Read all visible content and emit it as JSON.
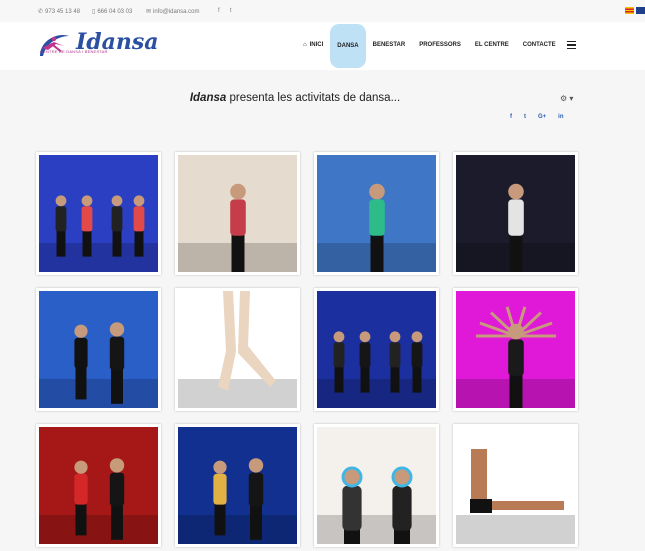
{
  "topbar": {
    "phone1": "973 45 13 48",
    "phone2": "666 04 03 03",
    "email": "info@idansa.com",
    "social": [
      "f",
      "t"
    ]
  },
  "logo": {
    "name": "Idansa",
    "tagline": "CENTRE DE DANSA I BENESTAR"
  },
  "nav": {
    "items": [
      "INICI",
      "DANSA",
      "BENESTAR",
      "PROFESSORS",
      "EL CENTRE",
      "CONTACTE"
    ],
    "active": "DANSA"
  },
  "page": {
    "brand": "Idansa",
    "headline_rest": "presenta les activitats de dansa...",
    "share": [
      "f",
      "t",
      "G+",
      "in"
    ]
  },
  "gallery": [
    {
      "bg": "#2a3fc2",
      "accent": "#e24a4a",
      "subject": "kids-dancers"
    },
    {
      "bg": "#e6dbcf",
      "accent": "#c53d4a",
      "subject": "girl-stretching-mat"
    },
    {
      "bg": "#3f77c6",
      "accent": "#2dbb8a",
      "subject": "girl-arms-up"
    },
    {
      "bg": "#1b1b2b",
      "accent": "#e4e4e4",
      "subject": "girl-sitting-stage"
    },
    {
      "bg": "#2b5fc8",
      "accent": "#111111",
      "subject": "two-dancers-floor"
    },
    {
      "bg": "#ffffff",
      "accent": "#e9d5c0",
      "subject": "pointe-shoes"
    },
    {
      "bg": "#1c2f9e",
      "accent": "#161616",
      "subject": "group-on-stage"
    },
    {
      "bg": "#e018d8",
      "accent": "#1a1a1a",
      "subject": "many-arms-dancer"
    },
    {
      "bg": "#a61818",
      "accent": "#d42828",
      "subject": "salsa-couple"
    },
    {
      "bg": "#12308f",
      "accent": "#e2b144",
      "subject": "couple-embrace"
    },
    {
      "bg": "#f4f0ec",
      "accent": "#3fb7e6",
      "subject": "party-glasses"
    },
    {
      "bg": "#ffffff",
      "accent": "#b97a56",
      "subject": "athlete-l-sit"
    }
  ]
}
